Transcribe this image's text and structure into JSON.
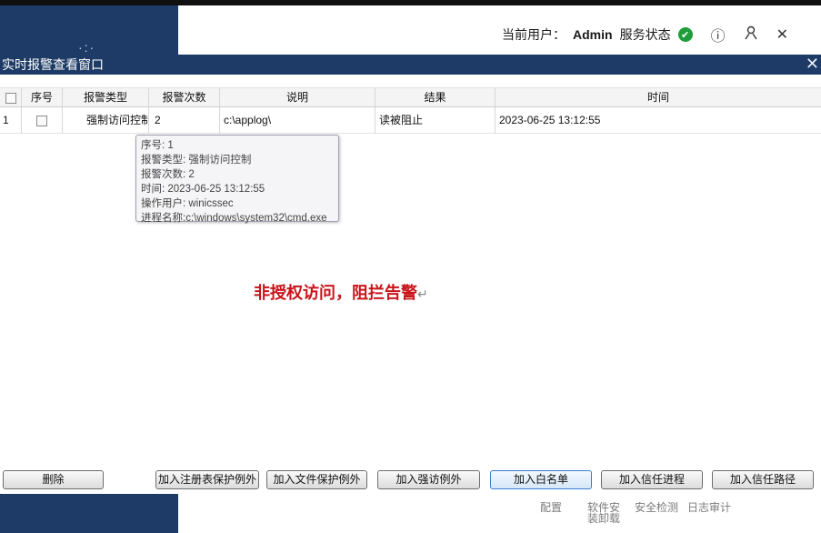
{
  "app": {
    "user_label": "当前用户：",
    "user_name": "Admin",
    "status_label": "服务状态",
    "bottom_nav": [
      "配置",
      "软件安装卸载",
      "安全检测",
      "日志审计"
    ]
  },
  "dialog": {
    "title": "实时报警查看窗口",
    "columns": [
      "序号",
      "报警类型",
      "报警次数",
      "说明",
      "结果",
      "时间"
    ],
    "rows": [
      {
        "index": "1",
        "type": "强制访问控制",
        "count": "2",
        "desc": "c:\\applog\\",
        "result": "读被阻止",
        "time": "2023-06-25 13:12:55"
      }
    ],
    "tooltip": [
      "序号: 1",
      "报警类型: 强制访问控制",
      "报警次数: 2",
      "时间: 2023-06-25 13:12:55",
      "操作用户: winicssec",
      "进程名称:c:\\windows\\system32\\cmd.exe"
    ],
    "notice": "非授权访问，阻拦告警",
    "buttons": [
      "删除",
      "加入注册表保护例外",
      "加入文件保护例外",
      "加入强访例外",
      "加入白名单",
      "加入信任进程",
      "加入信任路径"
    ]
  }
}
